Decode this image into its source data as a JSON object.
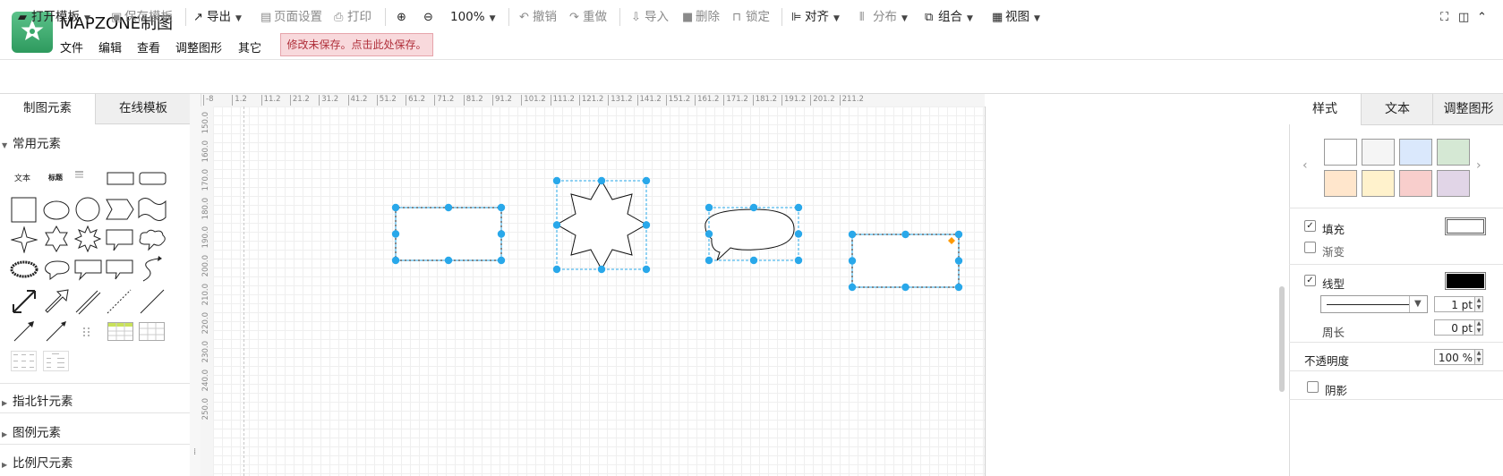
{
  "app": {
    "title": "MAPZONE制图",
    "menu": [
      "文件",
      "编辑",
      "查看",
      "调整图形",
      "其它"
    ],
    "save_notice": "修改未保存。点击此处保存。"
  },
  "toolbar": {
    "open_template": "打开模板",
    "save_template": "保存模板",
    "export": "导出",
    "page_setup": "页面设置",
    "print": "打印",
    "zoom_level": "100%",
    "undo": "撤销",
    "redo": "重做",
    "import": "导入",
    "delete": "删除",
    "lock": "锁定",
    "align": "对齐",
    "distribute": "分布",
    "group": "组合",
    "view": "视图"
  },
  "left_panel": {
    "tabs": [
      "制图元素",
      "在线模板"
    ],
    "sections": [
      "常用元素",
      "指北针元素",
      "图例元素",
      "比例尺元素"
    ],
    "palette_text": [
      "文本",
      "标题"
    ]
  },
  "rulers": {
    "h_ticks": [
      "-8",
      "1.2",
      "11.2",
      "21.2",
      "31.2",
      "41.2",
      "51.2",
      "61.2",
      "71.2",
      "81.2",
      "91.2",
      "101.2",
      "111.2",
      "121.2",
      "131.2",
      "141.2",
      "151.2",
      "161.2",
      "171.2",
      "181.2",
      "191.2",
      "201.2",
      "211.2"
    ],
    "v_ticks": [
      "150.0",
      "160.0",
      "170.0",
      "180.0",
      "190.0",
      "200.0",
      "210.0",
      "220.0",
      "230.0",
      "240.0",
      "250.0"
    ]
  },
  "right_panel": {
    "tabs": [
      "样式",
      "文本",
      "调整图形"
    ],
    "swatches_row1": [
      "#ffffff",
      "#f5f5f5",
      "#dae8fc",
      "#d5e8d4"
    ],
    "swatches_row2": [
      "#ffe6cc",
      "#fff2cc",
      "#f8cecc",
      "#e1d5e7"
    ],
    "fill_label": "填充",
    "gradient_label": "渐变",
    "line_label": "线型",
    "line_width": "1 pt",
    "perimeter_label": "周长",
    "perimeter_value": "0 pt",
    "opacity_label": "不透明度",
    "opacity_value": "100 %",
    "shadow_label": "阴影",
    "fill_color": "#ffffff",
    "line_color": "#000000",
    "fill_checked": true,
    "line_checked": true
  },
  "colors": {
    "selection": "#29a8ea",
    "accent_green": "#3ba96b"
  }
}
